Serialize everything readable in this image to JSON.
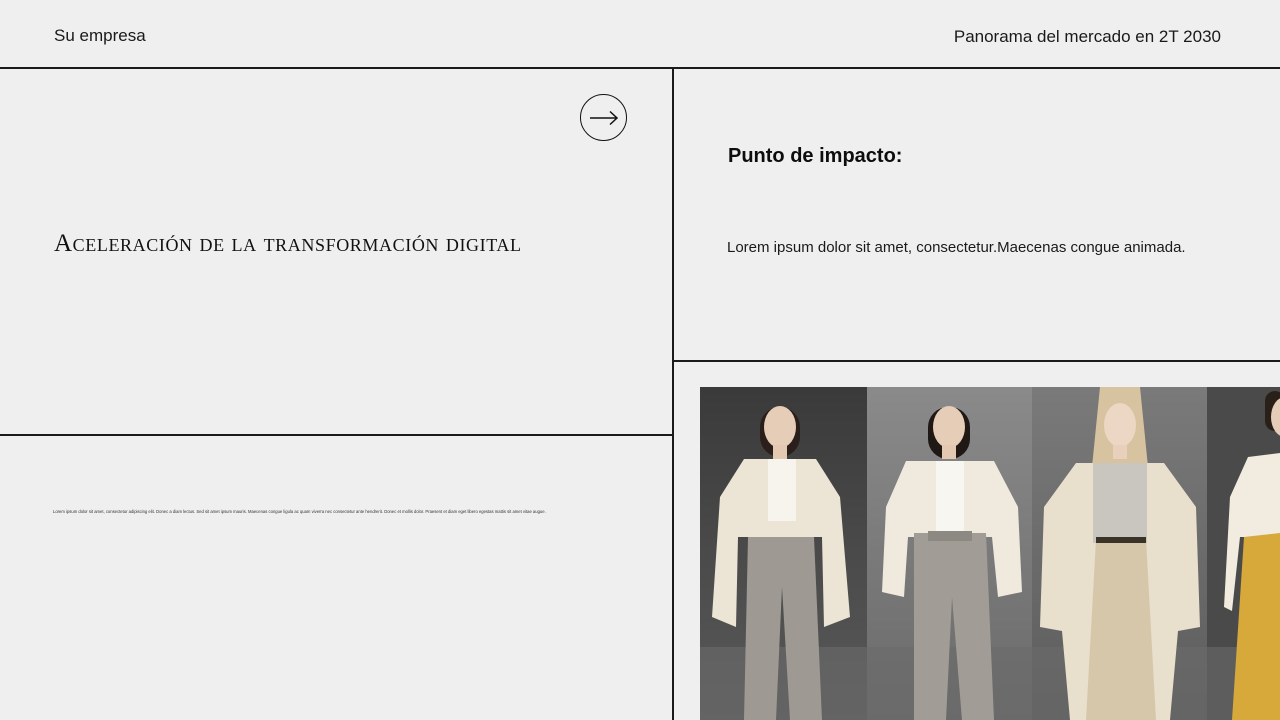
{
  "header": {
    "company": "Su empresa",
    "title": "Panorama del mercado en 2T 2030"
  },
  "left_panel": {
    "title": "Aceleración de la transformación digital",
    "body": "Lorem ipsum dolor sit amet, consectetur adipiscing elit. Donec a diam lectus. Sed sit amet ipsum mauris. Maecenas congue ligula ac quam viverra nec consectetur ante hendrerit. Donec et mollis dolor. Praesent et diam eget libero egestas mattis sit amet vitae augue."
  },
  "right_panel": {
    "heading": "Punto de impacto:",
    "body": "Lorem ipsum dolor sit amet, consectetur.Maecenas congue animada."
  },
  "icons": {
    "next": "arrow-right-icon"
  },
  "photo": {
    "subject": "runway-models-photo"
  },
  "colors": {
    "background": "#efefef",
    "lines": "#1a1a1a",
    "text": "#111111"
  }
}
